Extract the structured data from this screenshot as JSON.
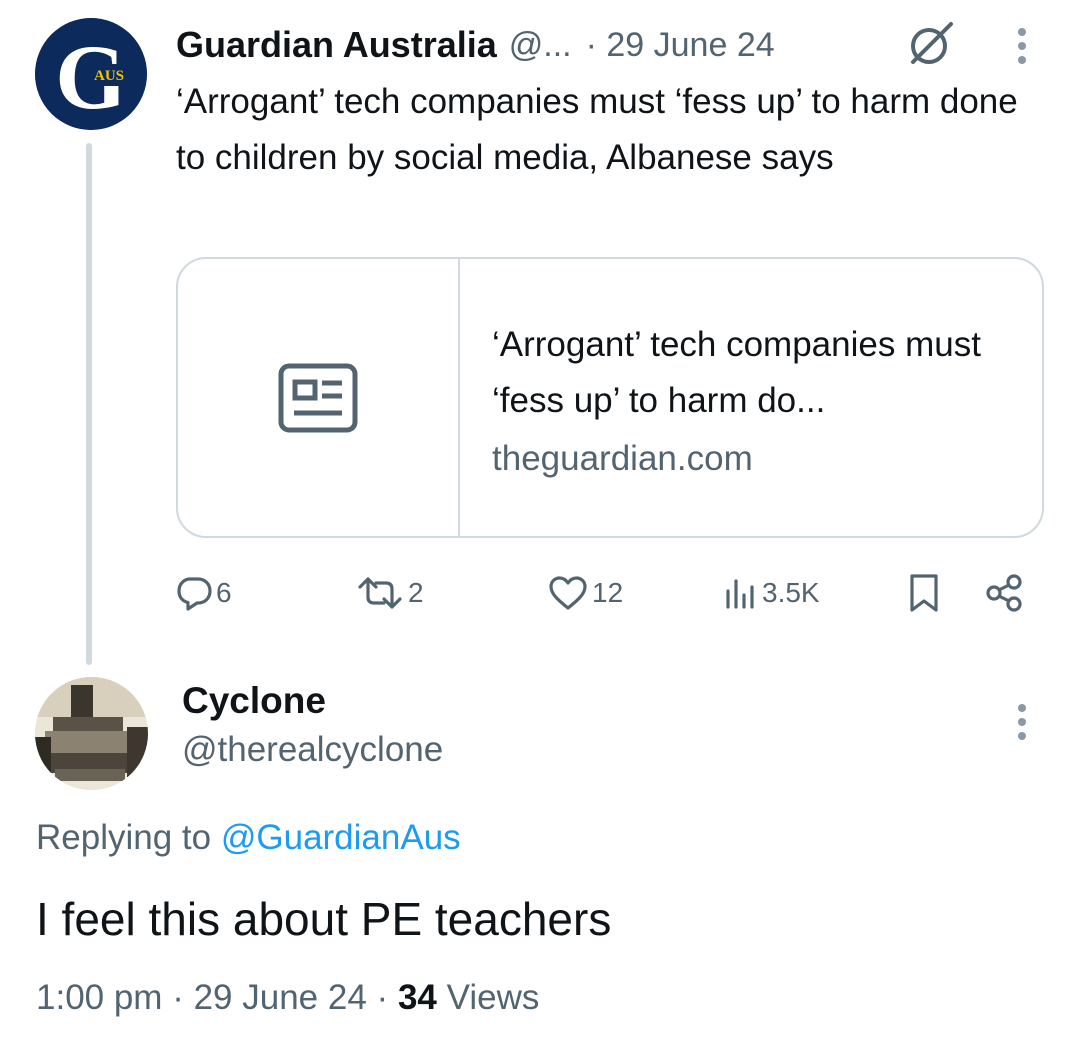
{
  "tweet": {
    "avatar_label": "AUS",
    "display_name": "Guardian Australia",
    "handle": "@...",
    "date": "· 29 June 24",
    "text": "‘Arrogant’ tech companies must ‘fess up’ to harm done to children by social media, Albanese says",
    "card": {
      "title": "‘Arrogant’ tech companies must ‘fess up’ to harm do...",
      "domain": "theguardian.com"
    },
    "actions": {
      "replies": "6",
      "retweets": "2",
      "likes": "12",
      "views": "3.5K"
    }
  },
  "reply": {
    "display_name": "Cyclone",
    "handle": "@therealcyclone",
    "replying_prefix": "Replying to",
    "replying_to": "@GuardianAus",
    "text": "I feel this about PE teachers",
    "time": "1:00 pm",
    "date": "29 June 24",
    "views_count": "34",
    "views_label": "Views"
  },
  "colors": {
    "text": "#0f1419",
    "secondary": "#536471",
    "link": "#1d9bf0",
    "border": "#cfd9de",
    "guardian_blue": "#0d2a5c"
  }
}
